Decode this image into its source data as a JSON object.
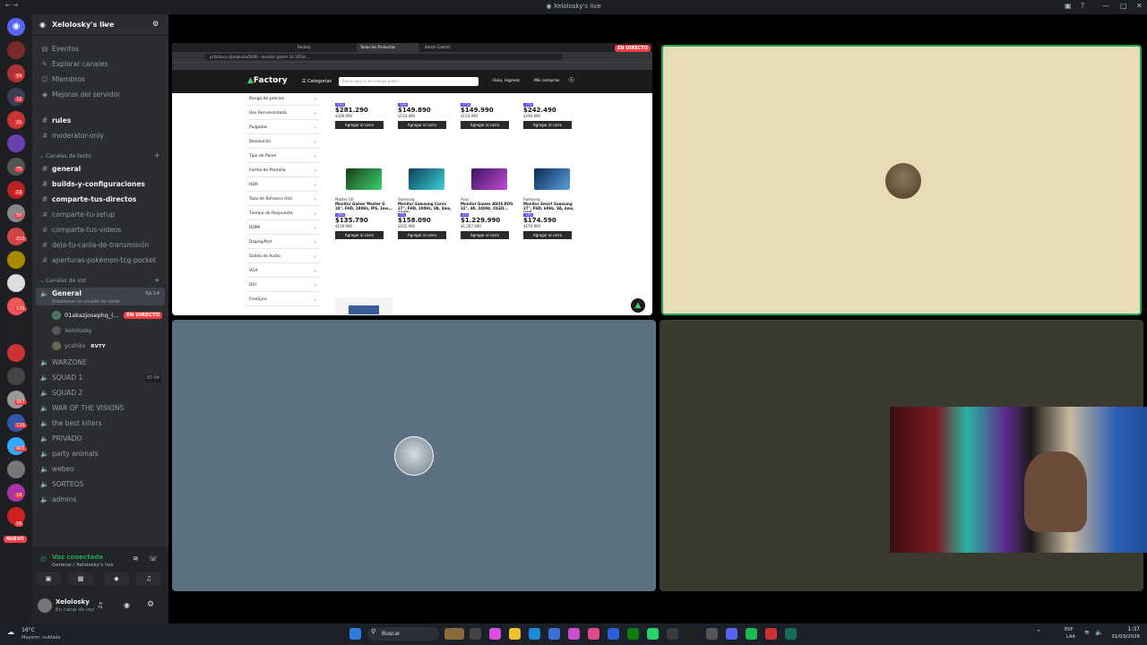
{
  "window": {
    "title": "Xelolosky's live"
  },
  "server": {
    "name": "Xelolosky's live"
  },
  "nav_items": [
    {
      "label": "Eventos",
      "icon": "calendar-icon"
    },
    {
      "label": "Explorar canales",
      "icon": "compass-icon"
    },
    {
      "label": "Miembros",
      "icon": "members-icon"
    },
    {
      "label": "Mejoras del servidor",
      "icon": "boost-icon"
    }
  ],
  "top_channels": [
    {
      "label": "rules",
      "bold": true
    },
    {
      "label": "moderator-only",
      "bold": false
    }
  ],
  "text_category": "Canales de texto",
  "text_channels": [
    {
      "label": "general",
      "bold": true
    },
    {
      "label": "builds-y-configuraciones",
      "bold": true
    },
    {
      "label": "comparte-tus-directos",
      "bold": true
    },
    {
      "label": "comparte-tu-setup",
      "bold": false
    },
    {
      "label": "comparte-tus-videos",
      "bold": false
    },
    {
      "label": "deja-tu-canla-de-transmisión",
      "bold": false
    },
    {
      "label": "aperturas-pokémon-tcg-pocket",
      "bold": false
    }
  ],
  "voice_category": "Canales de voz",
  "voice_general": {
    "label": "General",
    "timer": "5á:14",
    "status": "Establecer un estado de canal"
  },
  "voice_users": [
    {
      "name": "01akazjosephq_(...",
      "badge": "EN DIRECTO"
    },
    {
      "name": "Xelolosky",
      "badge": ""
    },
    {
      "name": "ycshito",
      "badge": "RVTY"
    }
  ],
  "voice_channels": [
    {
      "label": "WARZONE",
      "extra": ""
    },
    {
      "label": "SQUAD 1",
      "extra": "00 04"
    },
    {
      "label": "SQUAD 2",
      "extra": ""
    },
    {
      "label": "WAR OF THE VISIONS",
      "extra": ""
    },
    {
      "label": "the best killers",
      "extra": ""
    },
    {
      "label": "PRIVADO",
      "extra": ""
    },
    {
      "label": "party animals",
      "extra": ""
    },
    {
      "label": "webeo",
      "extra": ""
    },
    {
      "label": "SORTEOS",
      "extra": ""
    },
    {
      "label": "admins",
      "extra": ""
    }
  ],
  "voice_panel": {
    "status": "Voz conectada",
    "location": "General / Xelolosky's live"
  },
  "user_panel": {
    "name": "Xelolosky",
    "status": "En canal de voz"
  },
  "guild_new_badge": "NUEVO",
  "guild_badges": [
    "54",
    "12",
    "21",
    "75",
    "19",
    "50",
    "210",
    "136",
    "367",
    "129",
    "905",
    "18",
    "16"
  ],
  "stream": {
    "live_badge": "EN DIRECTO",
    "tabs": [
      "Factory",
      "Todos los Productos",
      "Smart Control"
    ],
    "url": "pcfactory.cl/producto/5000 - monitor gamer 24 165hz ...",
    "store": {
      "logo": "Factory",
      "menu": "Categorías",
      "search_placeholder": "Busca aquí tu tecnología pedorl",
      "login": "Hola, Ingresa",
      "purchases": "Mis compras"
    },
    "filters": [
      "Rango de precios",
      "Uso Recomendado",
      "Pulgadas",
      "Resolución",
      "Tipo de Panel",
      "Forma de Pantalla",
      "HDR",
      "Tasa de Refresco (Hz)",
      "Tiempo de Respuesta",
      "HDMI",
      "DisplayPort",
      "Salida de Audio",
      "VGA",
      "DVI",
      "FreeSync"
    ],
    "top_products": [
      {
        "disc": "-26%",
        "price": "$281.290",
        "old": "$289.990"
      },
      {
        "disc": "-28%",
        "price": "$149.890",
        "old": "$154.490"
      },
      {
        "disc": "-27%",
        "price": "$149.990",
        "old": "$154.990"
      },
      {
        "disc": "-17%",
        "price": "$242.490",
        "old": "$249.990"
      }
    ],
    "products": [
      {
        "brand": "Master G6",
        "name": "Monitor Gamer Master G 24\", FHD, 180Hz, IPS, 1ms...",
        "disc": "-38%",
        "price": "$135.790",
        "old": "$109.990"
      },
      {
        "brand": "Samsung",
        "name": "Monitor Samsung Curvo 27\", FHD, 100Hz, VA, 4ms, 1080p...",
        "disc": "-7%",
        "price": "$158.090",
        "old": "$162.990"
      },
      {
        "brand": "Asus",
        "name": "Monitor Gamer ASUS ROG 32\", 4K, 240Hz, OLED...",
        "disc": "-5%",
        "price": "$1.229.990",
        "old": "$1.267.990"
      },
      {
        "brand": "Samsung",
        "name": "Monitor Smart Samsung 27\", FHD, 60Hz, VA, 4ms, HDR...",
        "disc": "-28%",
        "price": "$174.590",
        "old": "$179.990"
      }
    ],
    "add_to_cart": "Agregar al carro"
  },
  "taskbar": {
    "weather_temp": "16°C",
    "weather_desc": "Mayorm. nublado",
    "search": "Buscar",
    "lang": "ESP",
    "lang2": "LAA",
    "time": "1:37",
    "date": "31/03/2026"
  }
}
